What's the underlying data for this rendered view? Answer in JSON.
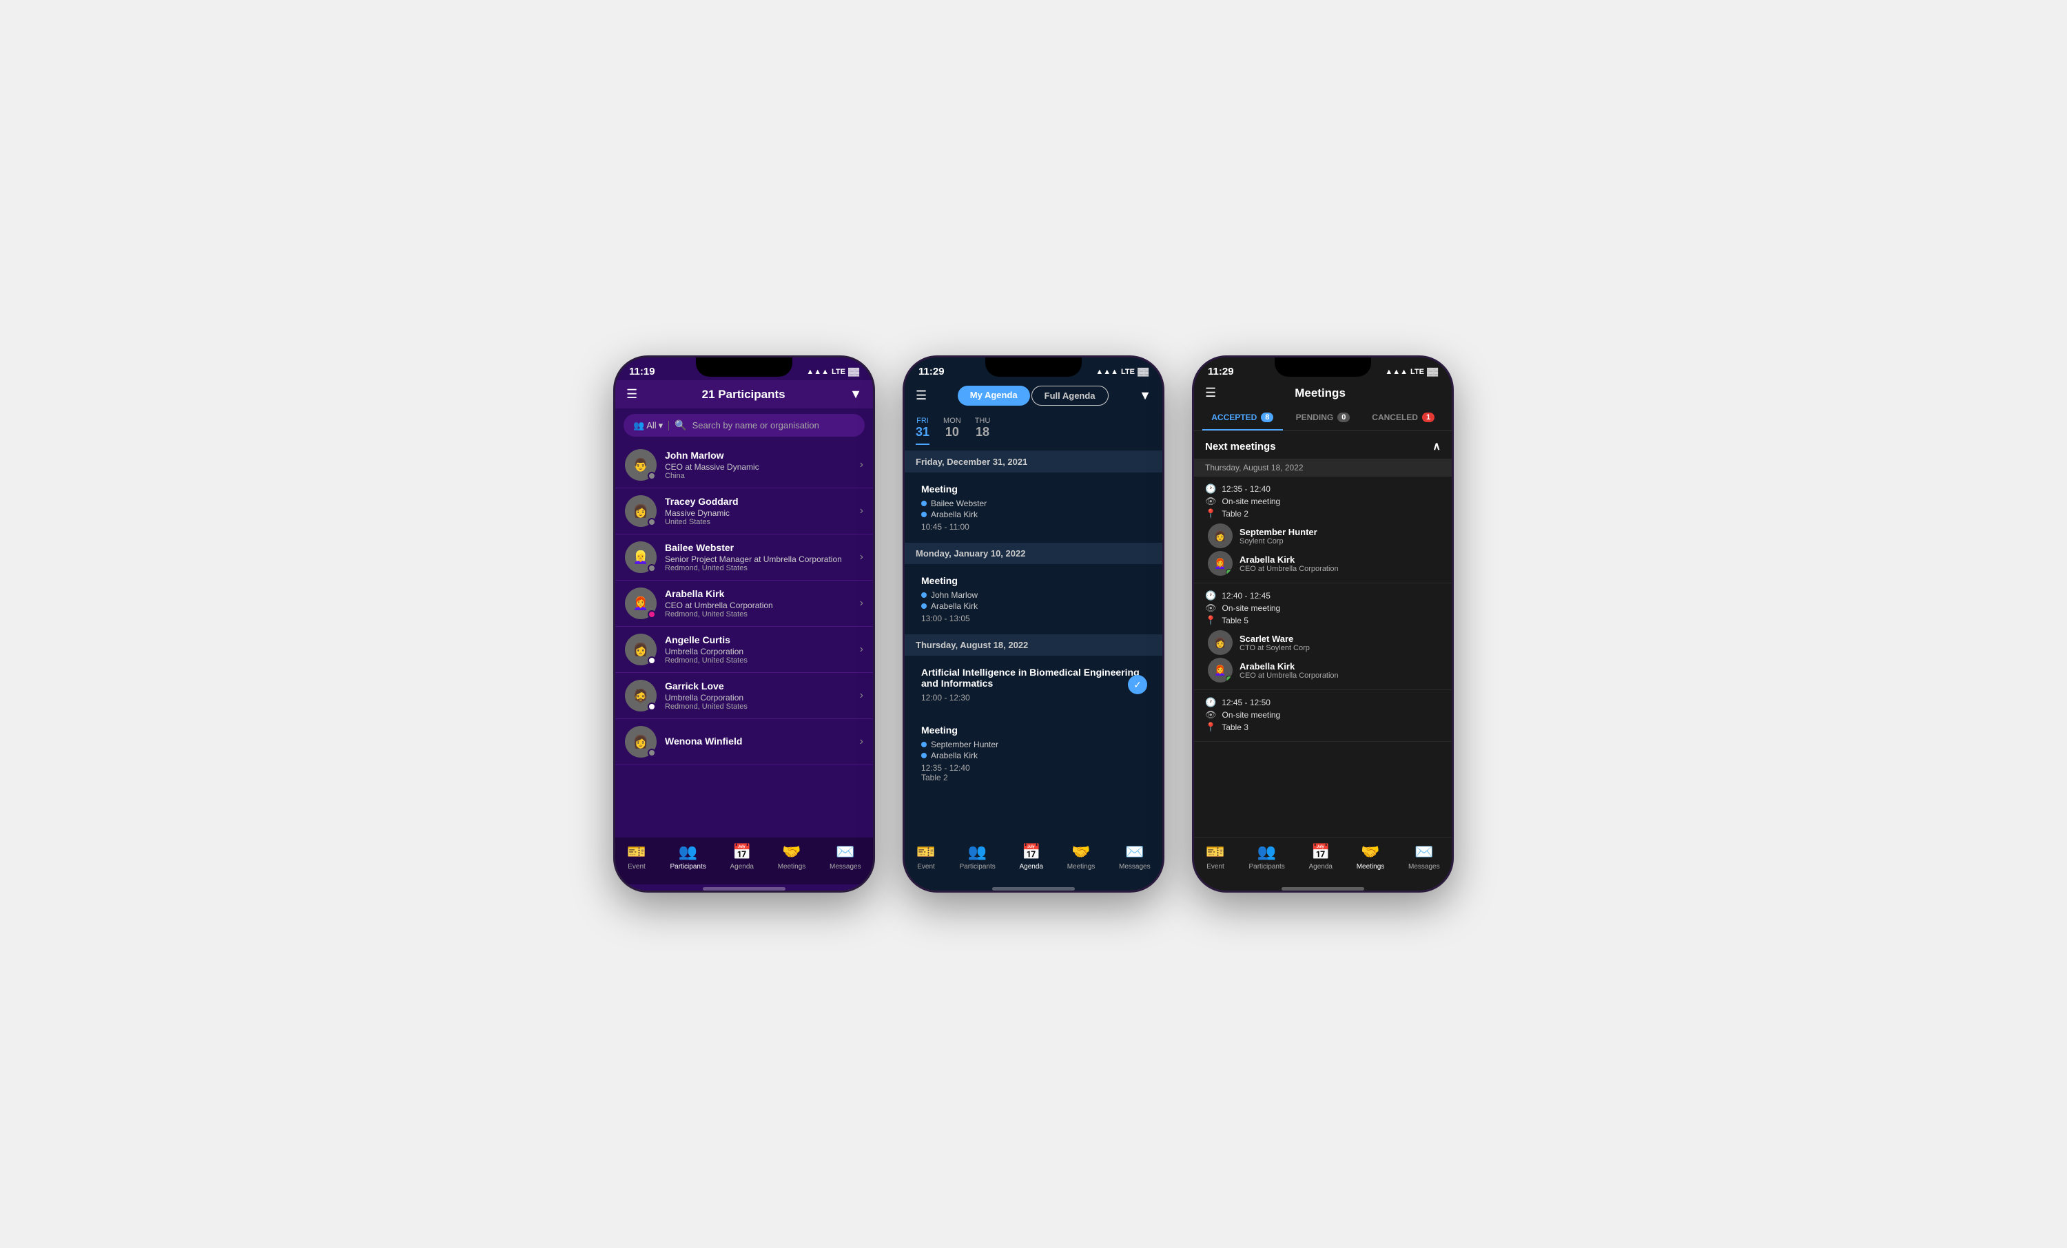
{
  "phone1": {
    "statusBar": {
      "time": "11:19",
      "signal": "▲▲▲",
      "network": "LTE",
      "battery": "🔋"
    },
    "header": {
      "title": "21 Participants",
      "filterLabel": "filter"
    },
    "search": {
      "placeholder": "Search by name or organisation",
      "allLabel": "All"
    },
    "participants": [
      {
        "id": 1,
        "name": "John Marlow",
        "org": "CEO at Massive Dynamic",
        "location": "China",
        "dot": "dot-gray",
        "emoji": "👨"
      },
      {
        "id": 2,
        "name": "Tracey Goddard",
        "org": "Massive Dynamic",
        "location": "United States",
        "dot": "dot-gray",
        "emoji": "👩"
      },
      {
        "id": 3,
        "name": "Bailee Webster",
        "org": "Senior Project Manager at Umbrella Corporation",
        "location": "Redmond, United States",
        "dot": "dot-gray",
        "emoji": "👱‍♀️"
      },
      {
        "id": 4,
        "name": "Arabella Kirk",
        "org": "CEO at Umbrella Corporation",
        "location": "Redmond, United States",
        "dot": "dot-pink",
        "emoji": "👩‍🦰"
      },
      {
        "id": 5,
        "name": "Angelle Curtis",
        "org": "Umbrella Corporation",
        "location": "Redmond, United States",
        "dot": "dot-white",
        "emoji": "👩"
      },
      {
        "id": 6,
        "name": "Garrick Love",
        "org": "Umbrella Corporation",
        "location": "Redmond, United States",
        "dot": "dot-white",
        "emoji": "🧔"
      },
      {
        "id": 7,
        "name": "Wenona Winfield",
        "org": "",
        "location": "",
        "dot": "dot-gray",
        "emoji": "👩"
      }
    ],
    "nav": [
      {
        "id": "event",
        "label": "Event",
        "icon": "🎫",
        "active": false
      },
      {
        "id": "participants",
        "label": "Participants",
        "icon": "👥",
        "active": true
      },
      {
        "id": "agenda",
        "label": "Agenda",
        "icon": "📅",
        "active": false
      },
      {
        "id": "meetings",
        "label": "Meetings",
        "icon": "🤝",
        "active": false
      },
      {
        "id": "messages",
        "label": "Messages",
        "icon": "✉️",
        "active": false
      }
    ]
  },
  "phone2": {
    "statusBar": {
      "time": "11:29",
      "signal": "▲▲▲",
      "network": "LTE",
      "battery": "🔋"
    },
    "tabs": [
      {
        "id": "my-agenda",
        "label": "My Agenda",
        "active": true
      },
      {
        "id": "full-agenda",
        "label": "Full Agenda",
        "active": false
      }
    ],
    "dateTabs": [
      {
        "id": "fri31",
        "dayName": "FRI",
        "dayNum": "31",
        "active": true
      },
      {
        "id": "mon10",
        "dayName": "MON",
        "dayNum": "10",
        "active": false
      },
      {
        "id": "thu18",
        "dayName": "THU",
        "dayNum": "18",
        "active": false
      }
    ],
    "sections": [
      {
        "id": "sec1",
        "dateLabel": "Friday, December 31, 2021",
        "meetings": [
          {
            "id": "m1",
            "title": "Meeting",
            "attendees": [
              "Bailee Webster",
              "Arabella Kirk"
            ],
            "time": "10:45 - 11:00",
            "location": "",
            "hasCheck": false
          }
        ]
      },
      {
        "id": "sec2",
        "dateLabel": "Monday, January 10, 2022",
        "meetings": [
          {
            "id": "m2",
            "title": "Meeting",
            "attendees": [
              "John Marlow",
              "Arabella Kirk"
            ],
            "time": "13:00 - 13:05",
            "location": "",
            "hasCheck": false
          }
        ]
      },
      {
        "id": "sec3",
        "dateLabel": "Thursday, August 18, 2022",
        "meetings": [
          {
            "id": "m3",
            "title": "Artificial Intelligence in Biomedical Engineering and Informatics",
            "attendees": [],
            "time": "12:00 - 12:30",
            "location": "",
            "hasCheck": true
          },
          {
            "id": "m4",
            "title": "Meeting",
            "attendees": [
              "September Hunter",
              "Arabella Kirk"
            ],
            "time": "12:35 - 12:40",
            "location": "Table 2",
            "hasCheck": false
          }
        ]
      }
    ],
    "nav": [
      {
        "id": "event",
        "label": "Event",
        "icon": "🎫",
        "active": false
      },
      {
        "id": "participants",
        "label": "Participants",
        "icon": "👥",
        "active": false
      },
      {
        "id": "agenda",
        "label": "Agenda",
        "icon": "📅",
        "active": true
      },
      {
        "id": "meetings",
        "label": "Meetings",
        "icon": "🤝",
        "active": false
      },
      {
        "id": "messages",
        "label": "Messages",
        "icon": "✉️",
        "active": false
      }
    ]
  },
  "phone3": {
    "statusBar": {
      "time": "11:29",
      "signal": "▲▲▲",
      "network": "LTE",
      "battery": "🔋"
    },
    "header": {
      "title": "Meetings"
    },
    "tabs": [
      {
        "id": "accepted",
        "label": "ACCEPTED",
        "count": "8",
        "active": true
      },
      {
        "id": "pending",
        "label": "PENDING",
        "count": "0",
        "active": false
      },
      {
        "id": "canceled",
        "label": "CANCELED",
        "count": "1",
        "active": false,
        "canceled": true
      }
    ],
    "nextMeetingsLabel": "Next meetings",
    "meetingDateLabel": "Thursday, August 18, 2022",
    "slots": [
      {
        "id": "slot1",
        "time": "12:35 - 12:40",
        "type": "On-site meeting",
        "location": "Table 2",
        "people": [
          {
            "name": "September Hunter",
            "role": "Soylent Corp",
            "emoji": "👩"
          },
          {
            "name": "Arabella Kirk",
            "role": "CEO at Umbrella Corporation",
            "emoji": "👩‍🦰",
            "dotColor": "dot-green"
          }
        ]
      },
      {
        "id": "slot2",
        "time": "12:40 - 12:45",
        "type": "On-site meeting",
        "location": "Table 5",
        "people": [
          {
            "name": "Scarlet Ware",
            "role": "CTO at Soylent Corp",
            "emoji": "👩"
          },
          {
            "name": "Arabella Kirk",
            "role": "CEO at Umbrella Corporation",
            "emoji": "👩‍🦰",
            "dotColor": "dot-green"
          }
        ]
      },
      {
        "id": "slot3",
        "time": "12:45 - 12:50",
        "type": "On-site meeting",
        "location": "Table 3",
        "people": []
      }
    ],
    "nav": [
      {
        "id": "event",
        "label": "Event",
        "icon": "🎫",
        "active": false
      },
      {
        "id": "participants",
        "label": "Participants",
        "icon": "👥",
        "active": false
      },
      {
        "id": "agenda",
        "label": "Agenda",
        "icon": "📅",
        "active": false
      },
      {
        "id": "meetings",
        "label": "Meetings",
        "icon": "🤝",
        "active": true
      },
      {
        "id": "messages",
        "label": "Messages",
        "icon": "✉️",
        "active": false
      }
    ]
  }
}
